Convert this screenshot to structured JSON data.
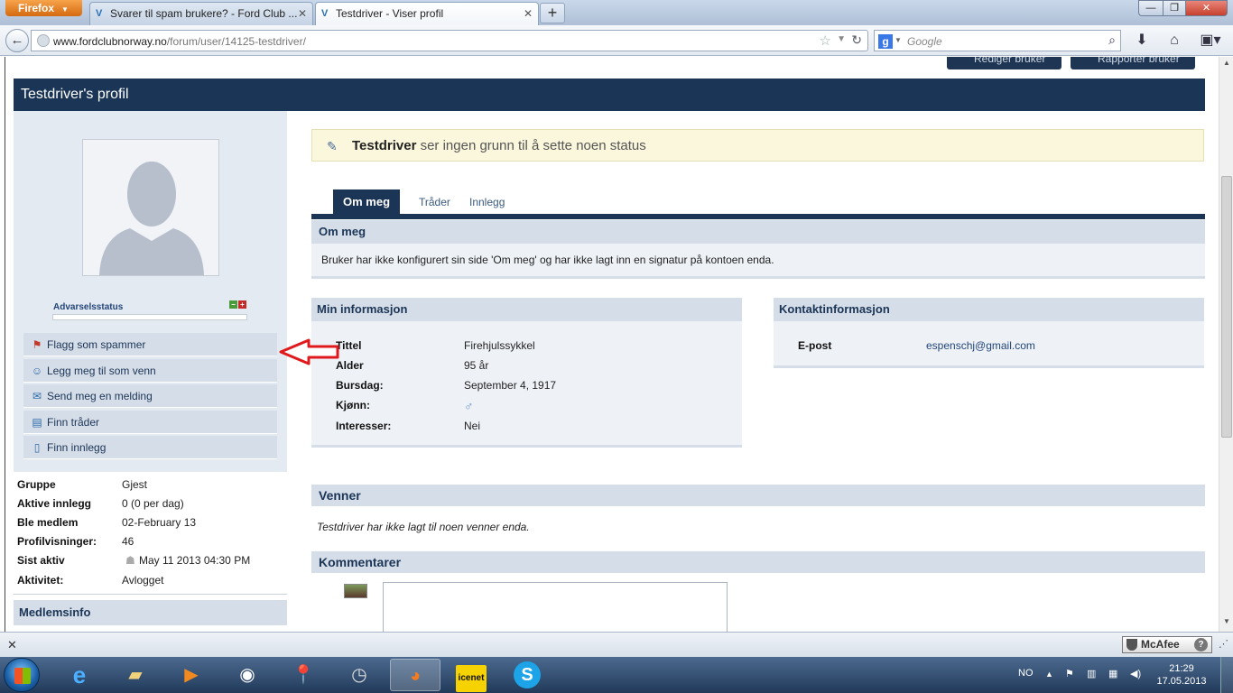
{
  "browser": {
    "menu_label": "Firefox",
    "tabs": [
      {
        "title": "Svarer til spam brukere? - Ford Club ..."
      },
      {
        "title": "Testdriver - Viser profil"
      }
    ],
    "url_domain": "www.fordclubnorway.no",
    "url_path": "/forum/user/14125-testdriver/",
    "search_placeholder": "Google"
  },
  "header_buttons": {
    "edit": "Rediger bruker",
    "report": "Rapporter bruker"
  },
  "profile": {
    "title": "Testdriver's profil",
    "warning_label": "Advarselsstatus",
    "actions": [
      {
        "label": "Flagg som spammer",
        "icon": "flag-spam-icon"
      },
      {
        "label": "Legg meg til som venn",
        "icon": "add-friend-icon"
      },
      {
        "label": "Send meg en melding",
        "icon": "message-icon"
      },
      {
        "label": "Finn tråder",
        "icon": "threads-icon"
      },
      {
        "label": "Finn innlegg",
        "icon": "posts-icon"
      }
    ],
    "stats": [
      {
        "key": "Gruppe",
        "value": "Gjest"
      },
      {
        "key": "Aktive innlegg",
        "value": "0 (0 per dag)"
      },
      {
        "key": "Ble medlem",
        "value": "02-February 13"
      },
      {
        "key": "Profilvisninger:",
        "value": "46"
      },
      {
        "key": "Sist aktiv",
        "value": "May 11 2013 04:30 PM"
      },
      {
        "key": "Aktivitet:",
        "value": "Avlogget"
      }
    ],
    "member_info_heading": "Medlemsinfo"
  },
  "status": {
    "username": "Testdriver",
    "text": "ser ingen grunn til å sette noen status"
  },
  "tabs": {
    "about": "Om meg",
    "threads": "Tråder",
    "posts": "Innlegg"
  },
  "about": {
    "heading": "Om meg",
    "text": "Bruker har ikke konfigurert sin side 'Om meg' og har ikke lagt inn en signatur på kontoen enda."
  },
  "my_info": {
    "heading": "Min informasjon",
    "rows": [
      {
        "key": "Tittel",
        "value": "Firehjulssykkel"
      },
      {
        "key": "Alder",
        "value": "95 år"
      },
      {
        "key": "Bursdag:",
        "value": "September 4, 1917"
      },
      {
        "key": "Kjønn:",
        "value": ""
      },
      {
        "key": "Interesser:",
        "value": "Nei"
      }
    ]
  },
  "contact": {
    "heading": "Kontaktinformasjon",
    "email_label": "E-post",
    "email": "espenschj@gmail.com"
  },
  "friends": {
    "heading": "Venner",
    "text": "Testdriver har ikke lagt til noen venner enda."
  },
  "comments": {
    "heading": "Kommentarer"
  },
  "addon_bar": {
    "mcafee": "McAfee"
  },
  "taskbar": {
    "lang": "NO",
    "icenet": "icenet",
    "time": "21:29",
    "date": "17.05.2013"
  },
  "colors": {
    "header": "#1b3556",
    "status_bg": "#fbf7dc",
    "panel_head": "#d5dde8",
    "arrow": "#e0191c"
  }
}
